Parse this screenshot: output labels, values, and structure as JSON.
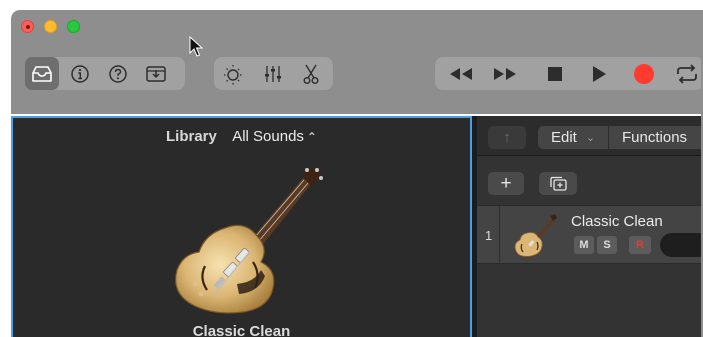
{
  "window": {
    "traffic_lights": {
      "close": "#fe5f57",
      "minimize": "#febc2e",
      "maximize": "#28c840"
    }
  },
  "toolbar": {
    "left_group": [
      "library-icon",
      "info-icon",
      "help-icon",
      "download-icon"
    ],
    "middle_group": [
      "brightness-icon",
      "mixer-icon",
      "scissors-icon"
    ],
    "transport": [
      "rewind-icon",
      "fast-forward-icon",
      "stop-icon",
      "play-icon",
      "record-icon",
      "cycle-icon"
    ],
    "record_color": "#ff3b30"
  },
  "library": {
    "title": "Library",
    "category": "All Sounds",
    "category_chevron": "⌃⌄",
    "patch_name": "Classic Clean",
    "focus_color": "#4c9ee9"
  },
  "tracks": {
    "up_arrow": "↑",
    "edit_label": "Edit",
    "edit_chevron": "⌄",
    "functions_label": "Functions",
    "add_label": "+",
    "track": {
      "number": "1",
      "name": "Classic Clean",
      "mute_label": "M",
      "solo_label": "S",
      "record_label": "R"
    }
  }
}
